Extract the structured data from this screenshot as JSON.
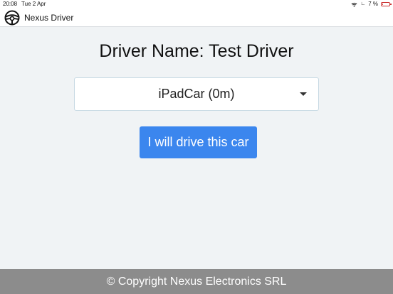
{
  "status_bar": {
    "time": "20:08",
    "date": "Tue 2 Apr",
    "battery": "7 %",
    "battery_color": "#cc3333"
  },
  "nav": {
    "app_title": "Nexus Driver",
    "logo_icon": "steering-wheel-icon"
  },
  "main": {
    "title": "Driver Name: Test Driver",
    "car_select": {
      "selected": "iPadCar (0m)"
    },
    "drive_button_label": "I will drive this car",
    "accent_color": "#3b86ee"
  },
  "footer": {
    "copyright": "© Copyright Nexus Electronics SRL",
    "background": "#8c8c8c"
  }
}
